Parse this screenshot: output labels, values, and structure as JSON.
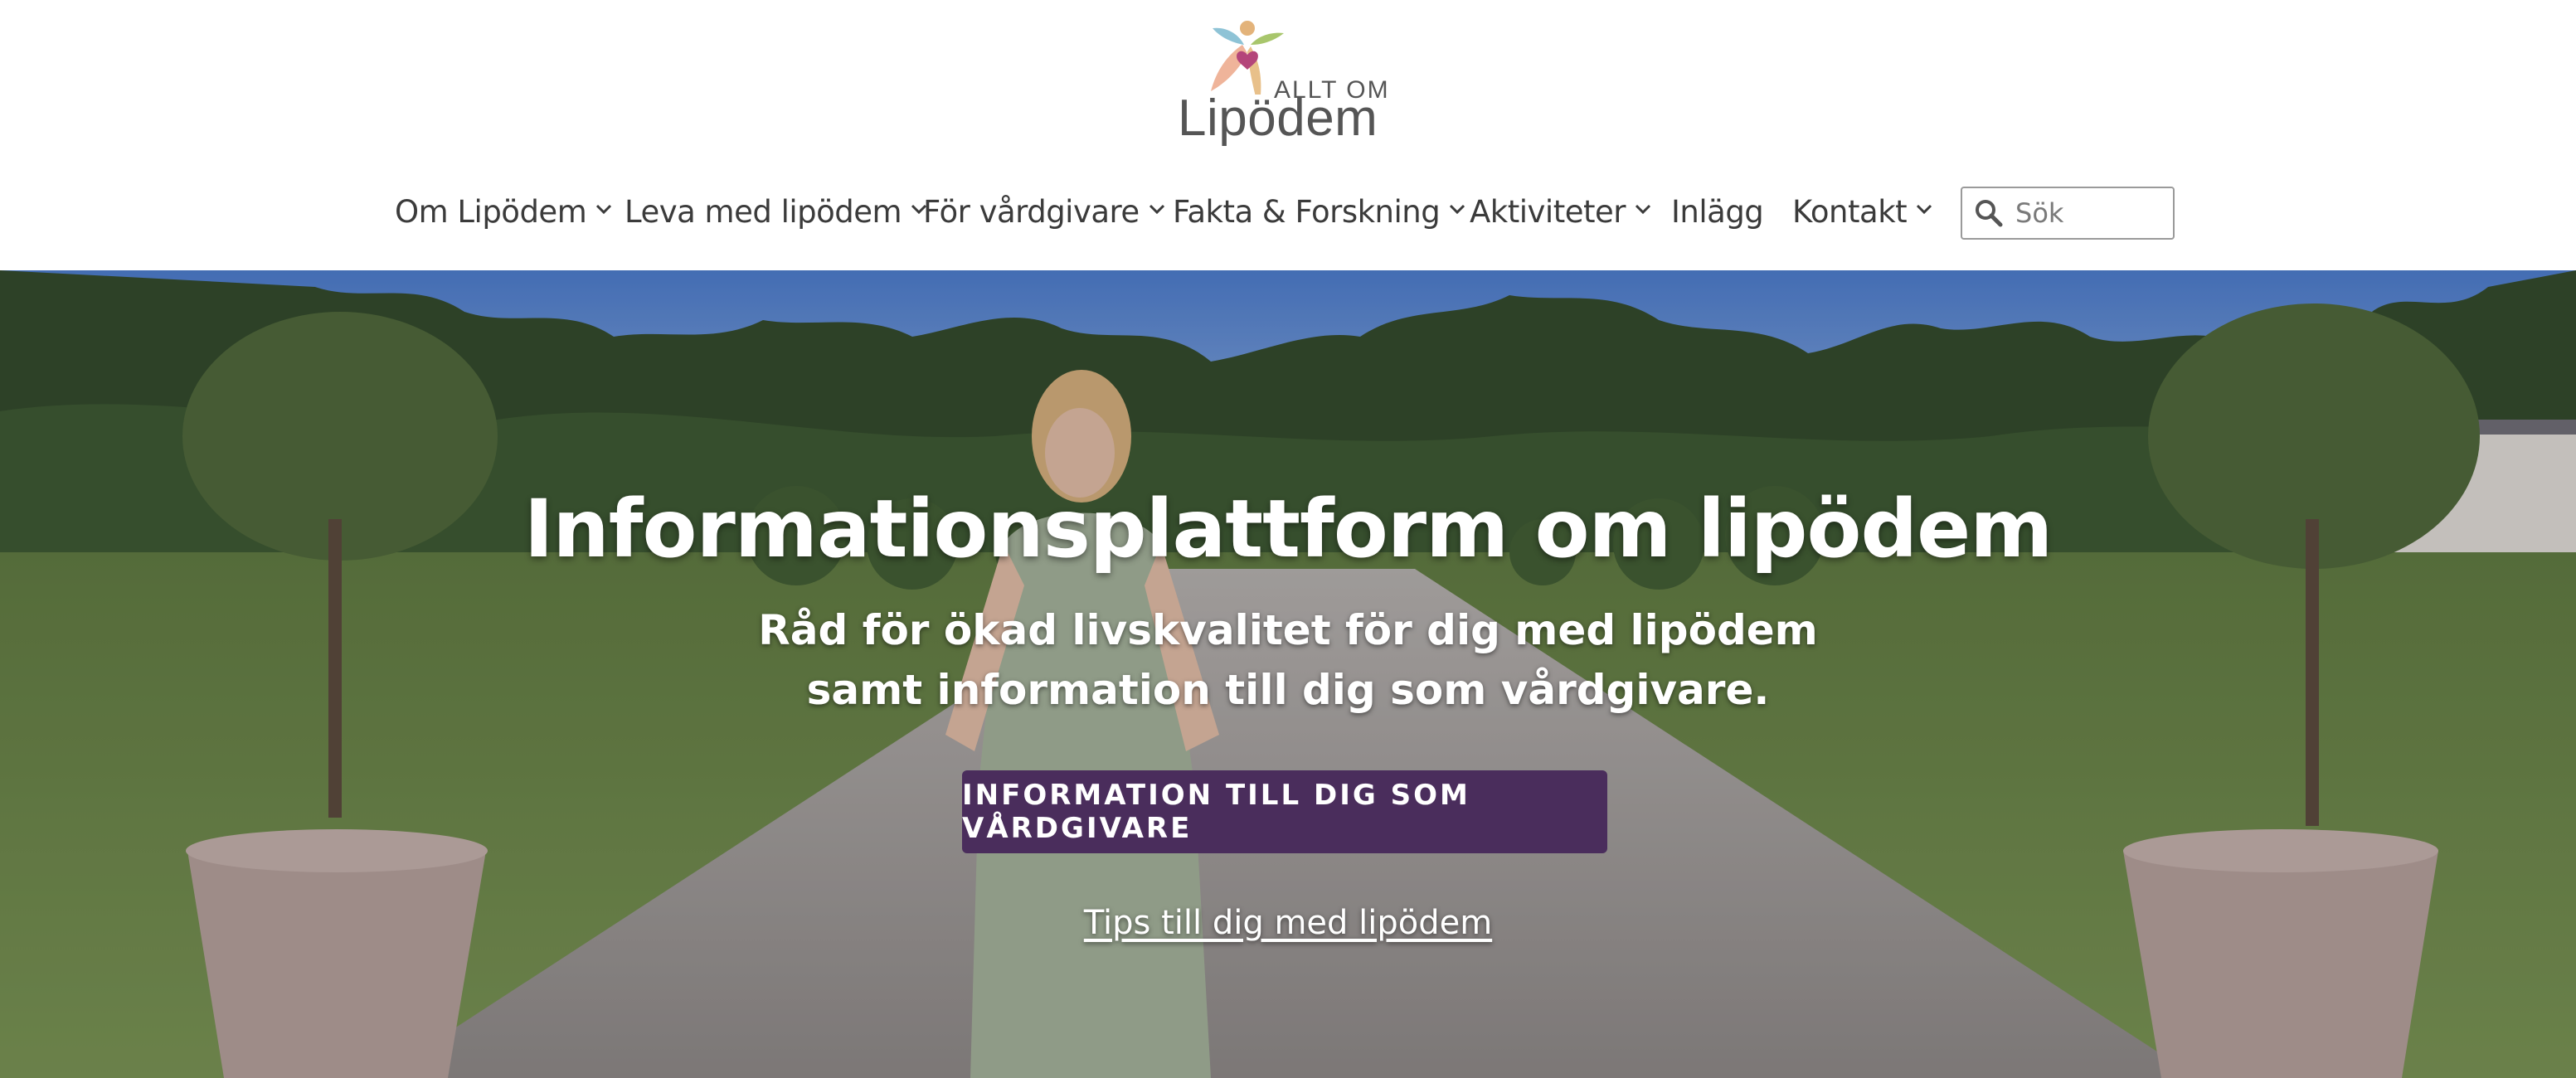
{
  "logo": {
    "small_text": "ALLT OM",
    "big_text": "Lipödem"
  },
  "nav": {
    "items": [
      {
        "label": "Om Lipödem",
        "has_dropdown": true
      },
      {
        "label": "Leva med lipödem",
        "has_dropdown": true
      },
      {
        "label": "För vårdgivare",
        "has_dropdown": true
      },
      {
        "label": "Fakta & Forskning",
        "has_dropdown": true
      },
      {
        "label": "Aktiviteter",
        "has_dropdown": true
      },
      {
        "label": "Inlägg",
        "has_dropdown": false
      },
      {
        "label": "Kontakt",
        "has_dropdown": true
      }
    ]
  },
  "search": {
    "placeholder": "Sök",
    "value": ""
  },
  "hero": {
    "title": "Informationsplattform om lipödem",
    "subtitle_line1": "Råd för ökad livskvalitet för dig med lipödem",
    "subtitle_line2": "samt information till dig som vårdgivare.",
    "button_label": "INFORMATION TILL DIG SOM VÅRDGIVARE",
    "link_label": "Tips till dig med lipödem"
  },
  "colors": {
    "brand_purple": "#4a2d5c",
    "nav_text": "#3b3b3b",
    "logo_text": "#555555"
  }
}
